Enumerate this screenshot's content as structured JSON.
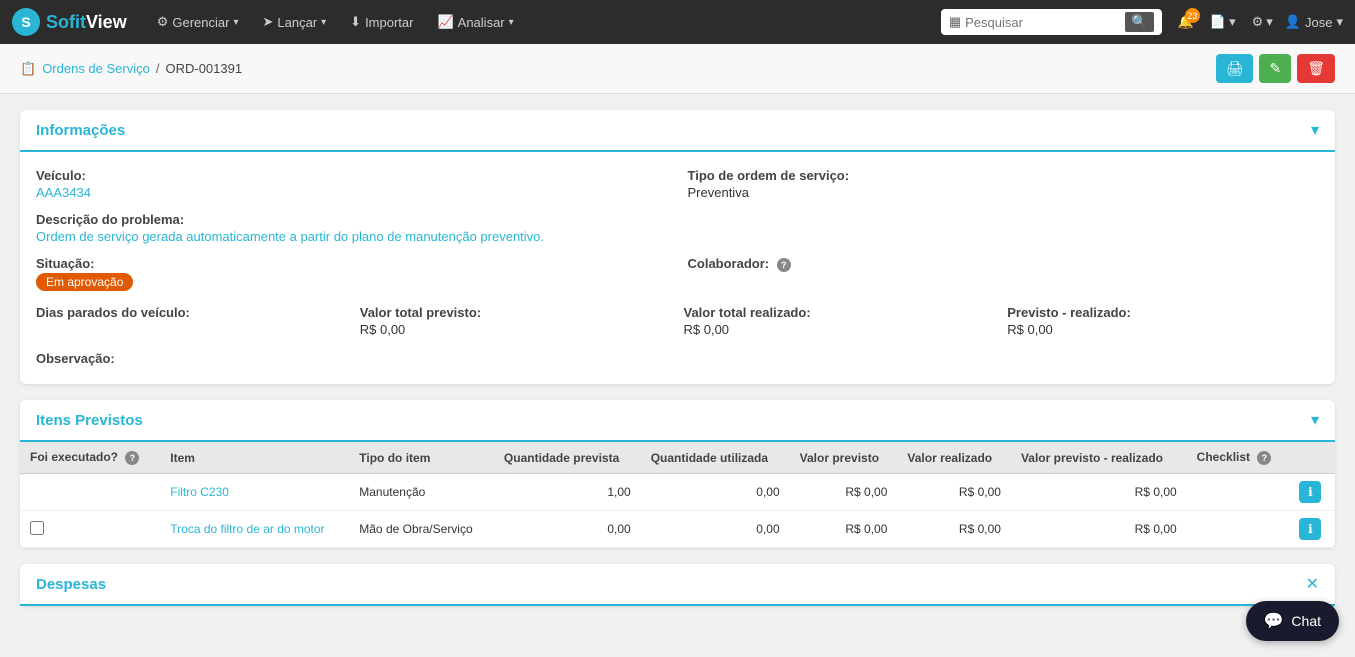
{
  "app": {
    "logo_sofit": "Sofit",
    "logo_view": "View"
  },
  "topnav": {
    "items": [
      {
        "label": "Gerenciar",
        "has_dropdown": true
      },
      {
        "label": "Lançar",
        "has_dropdown": true
      },
      {
        "label": "Importar",
        "has_dropdown": false
      },
      {
        "label": "Analisar",
        "has_dropdown": true
      }
    ],
    "search_placeholder": "Pesquisar",
    "notification_count": "23",
    "user_name": "Jose"
  },
  "breadcrumb": {
    "parent": "Ordens de Serviço",
    "separator": "/",
    "current": "ORD-001391"
  },
  "action_buttons": {
    "print": "🖨",
    "edit": "✎",
    "delete": "🗑"
  },
  "info_section": {
    "title": "Informações",
    "fields": {
      "veiculo_label": "Veículo:",
      "veiculo_value": "AAA3434",
      "tipo_label": "Tipo de ordem de serviço:",
      "tipo_value": "Preventiva",
      "descricao_label": "Descrição do problema:",
      "descricao_value": "Ordem de serviço gerada automaticamente a partir do plano de manutenção preventivo.",
      "situacao_label": "Situação:",
      "situacao_value": "Em aprovação",
      "colaborador_label": "Colaborador:",
      "dias_label": "Dias parados do veículo:",
      "valor_previsto_label": "Valor total previsto:",
      "valor_previsto_value": "R$ 0,00",
      "valor_realizado_label": "Valor total realizado:",
      "valor_realizado_value": "R$ 0,00",
      "previsto_realizado_label": "Previsto - realizado:",
      "previsto_realizado_value": "R$ 0,00",
      "observacao_label": "Observação:"
    }
  },
  "itens_section": {
    "title": "Itens Previstos",
    "columns": [
      "Foi executado?",
      "Item",
      "Tipo do item",
      "Quantidade prevista",
      "Quantidade utilizada",
      "Valor previsto",
      "Valor realizado",
      "Valor previsto - realizado",
      "Checklist"
    ],
    "rows": [
      {
        "executado": "",
        "item": "Filtro C230",
        "tipo": "Manutenção",
        "qtd_prevista": "1,00",
        "qtd_utilizada": "0,00",
        "valor_previsto": "R$ 0,00",
        "valor_realizado": "R$ 0,00",
        "valor_prev_realiz": "R$ 0,00"
      },
      {
        "executado": "checkbox",
        "item": "Troca do filtro de ar do motor",
        "tipo": "Mão de Obra/Serviço",
        "qtd_prevista": "0,00",
        "qtd_utilizada": "0,00",
        "valor_previsto": "R$ 0,00",
        "valor_realizado": "R$ 0,00",
        "valor_prev_realiz": "R$ 0,00"
      }
    ]
  },
  "despesas_section": {
    "title": "Despesas"
  },
  "chat": {
    "label": "Chat"
  }
}
